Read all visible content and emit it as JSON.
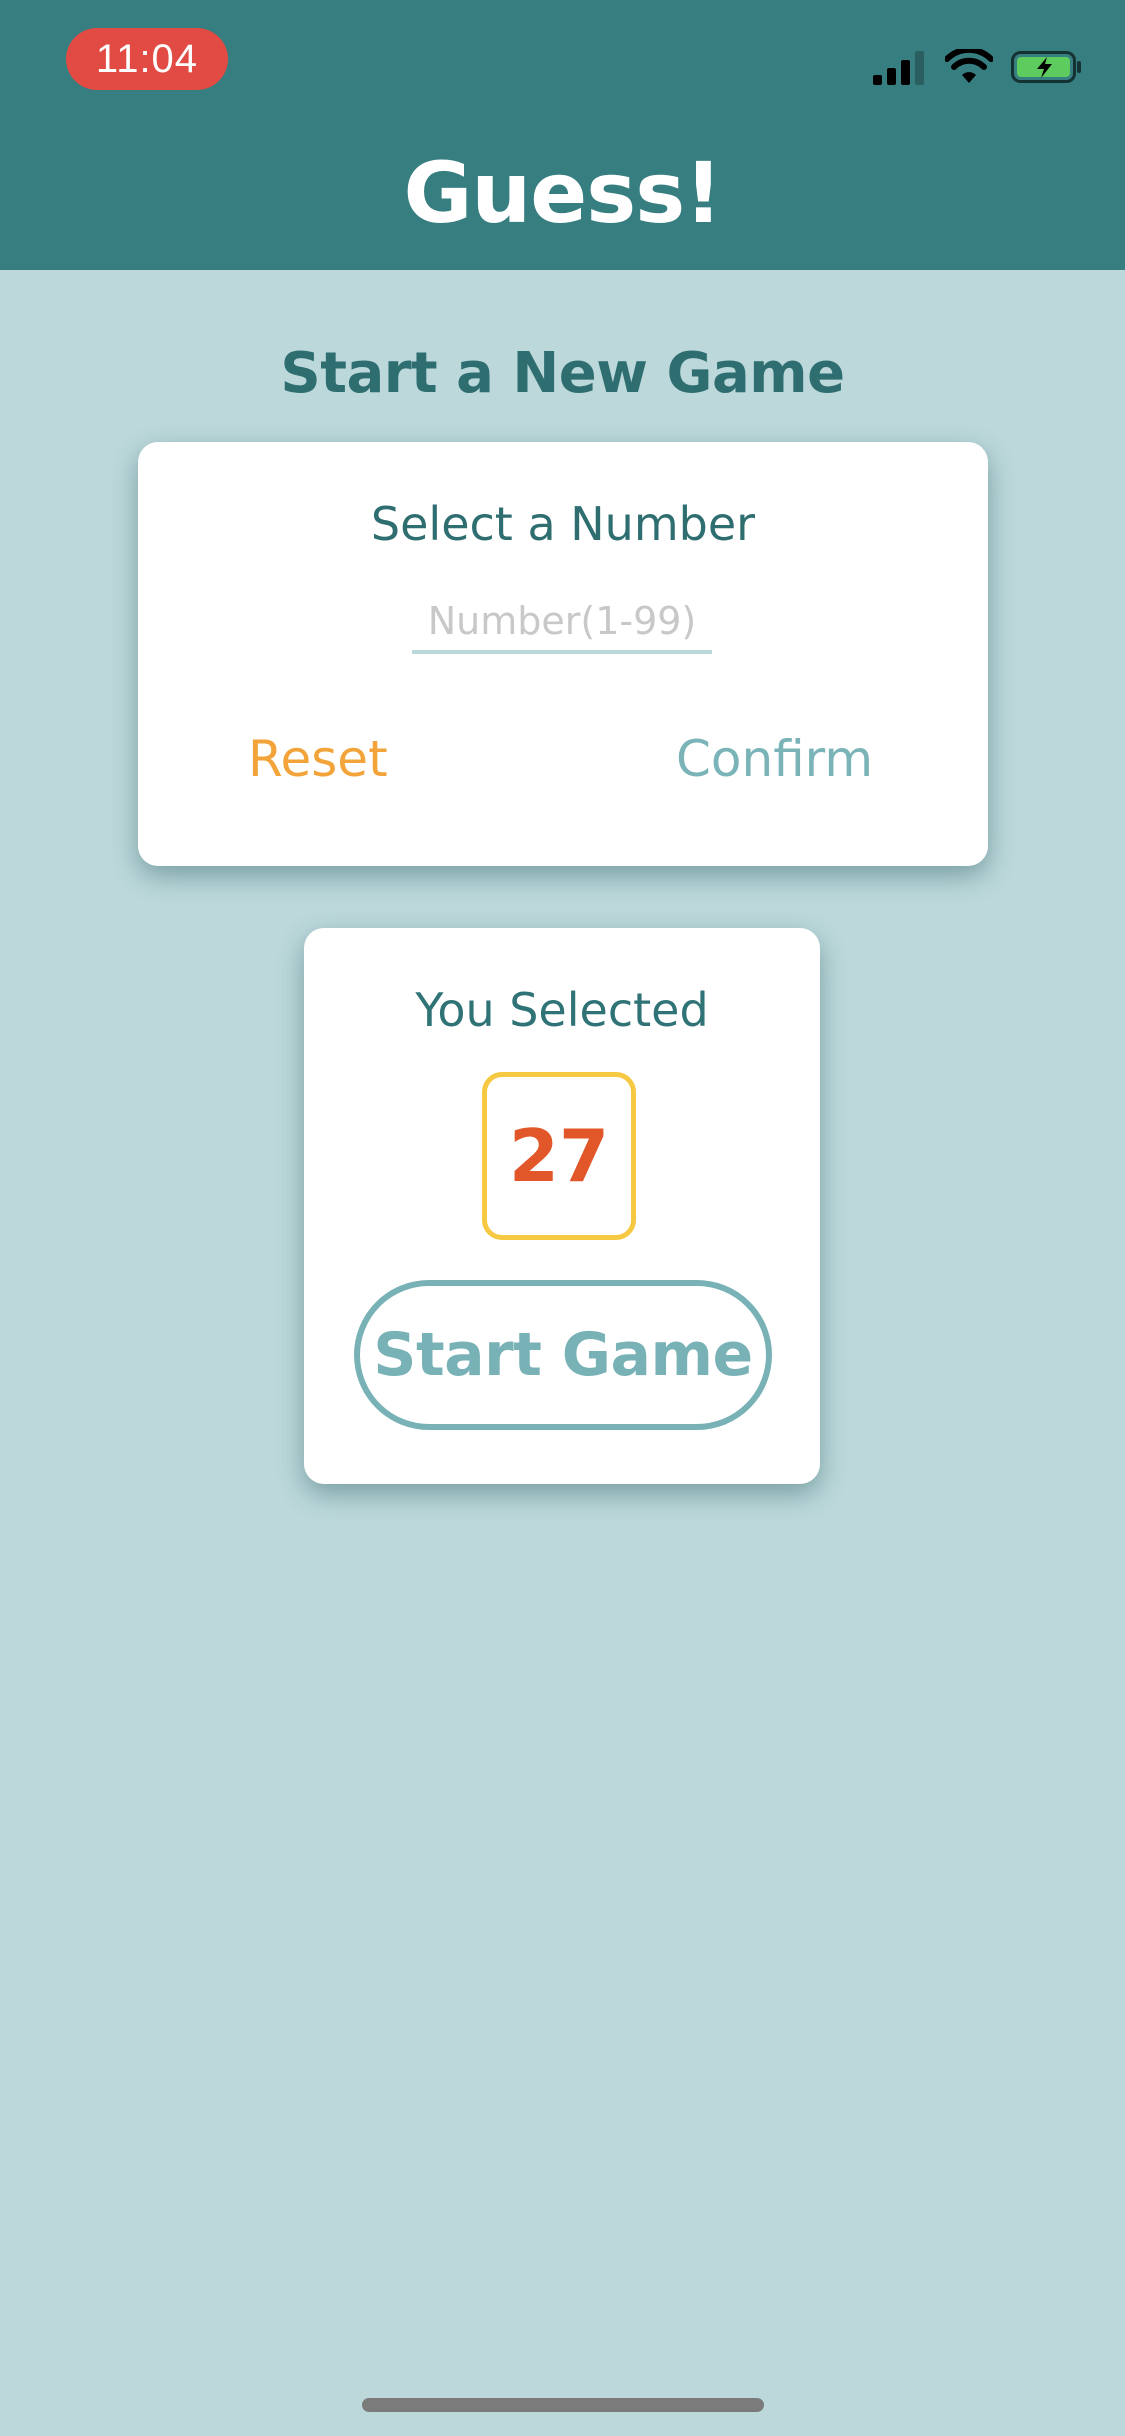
{
  "status_bar": {
    "time": "11:04",
    "icons": [
      "signal-icon",
      "wifi-icon",
      "battery-charging-icon"
    ]
  },
  "header": {
    "title": "Guess!"
  },
  "main": {
    "section_title": "Start a New Game",
    "select_card": {
      "title": "Select a Number",
      "input_value": "",
      "input_placeholder": "Number(1-99)",
      "reset_label": "Reset",
      "confirm_label": "Confirm"
    },
    "selected_card": {
      "label": "You Selected",
      "number": "27",
      "start_label": "Start Game"
    }
  },
  "colors": {
    "header_bg": "#367e80",
    "page_bg": "#bcd8db",
    "time_pill": "#e14b43",
    "reset": "#f2a43a",
    "confirm": "#7ab4b8",
    "number_border": "#f7c842",
    "number_text": "#e2572a",
    "start_button": "#78b2b6"
  }
}
